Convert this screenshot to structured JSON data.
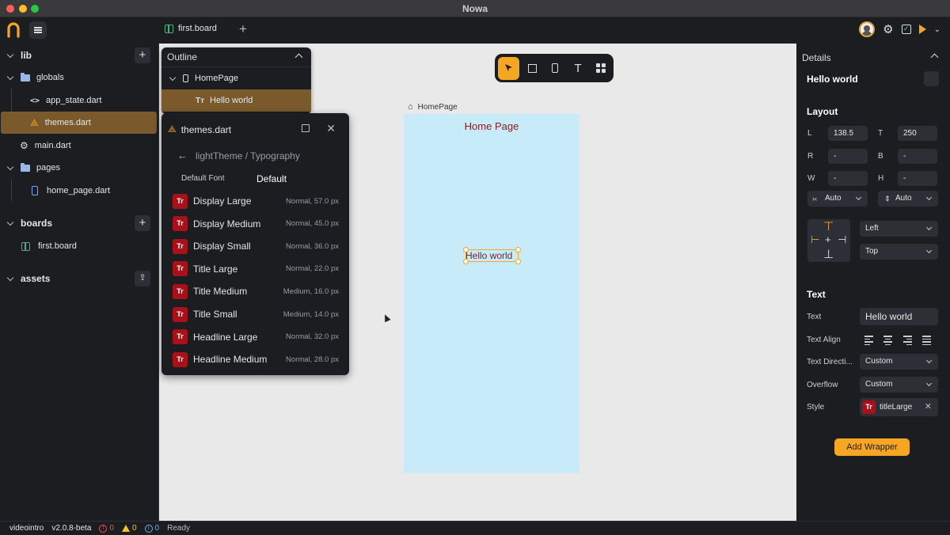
{
  "window": {
    "title": "Nowa"
  },
  "top_tab": {
    "label": "first.board"
  },
  "sidebar": {
    "lib": "lib",
    "globals": "globals",
    "app_state": "app_state.dart",
    "themes": "themes.dart",
    "main": "main.dart",
    "pages": "pages",
    "home_page": "home_page.dart",
    "boards": "boards",
    "first_board": "first.board",
    "assets": "assets"
  },
  "outline": {
    "title": "Outline",
    "items": [
      {
        "label": "HomePage",
        "icon": "phone-icon"
      },
      {
        "label": "Hello world",
        "icon": "text-icon"
      }
    ]
  },
  "themes_panel": {
    "title": "themes.dart",
    "breadcrumb": "lightTheme / Typography",
    "default_font_label": "Default Font",
    "default_font_value": "Default",
    "styles": [
      {
        "name": "Display Large",
        "meta": "Normal, 57.0 px"
      },
      {
        "name": "Display Medium",
        "meta": "Normal, 45.0 px"
      },
      {
        "name": "Display Small",
        "meta": "Normal, 36.0 px"
      },
      {
        "name": "Title Large",
        "meta": "Normal, 22.0 px"
      },
      {
        "name": "Title Medium",
        "meta": "Medium, 16.0 px"
      },
      {
        "name": "Title Small",
        "meta": "Medium, 14.0 px"
      },
      {
        "name": "Headline Large",
        "meta": "Normal, 32.0 px"
      },
      {
        "name": "Headline Medium",
        "meta": "Normal, 28.0 px"
      }
    ],
    "badge": "Tr"
  },
  "canvas": {
    "page_label": "HomePage",
    "page_title": "Home Page",
    "hello_text": "Hello world"
  },
  "details": {
    "title": "Details",
    "selected": "Hello world",
    "layout_title": "Layout",
    "L": "L",
    "L_value": "138.5",
    "T": "T",
    "T_value": "250",
    "R": "R",
    "R_value": "-",
    "B": "B",
    "B_value": "-",
    "W": "W",
    "W_value": "-",
    "H": "H",
    "H_value": "-",
    "width_mode": "Auto",
    "height_mode": "Auto",
    "h_align": "Left",
    "v_align": "Top",
    "text_title": "Text",
    "text_label": "Text",
    "text_value": "Hello world",
    "text_align_label": "Text Align",
    "text_direction_label": "Text Directi...",
    "text_direction_value": "Custom",
    "overflow_label": "Overflow",
    "overflow_value": "Custom",
    "style_label": "Style",
    "style_value": "titleLarge",
    "add_wrapper": "Add Wrapper"
  },
  "status": {
    "project": "videointro",
    "version": "v2.0.8-beta",
    "errors": "0",
    "warnings": "0",
    "infos": "0",
    "state": "Ready"
  },
  "colors": {
    "accent": "#f5a623",
    "selection": "#7a5a2c",
    "phone_bg": "#c8ebfa",
    "badge_red": "#a7121a"
  }
}
